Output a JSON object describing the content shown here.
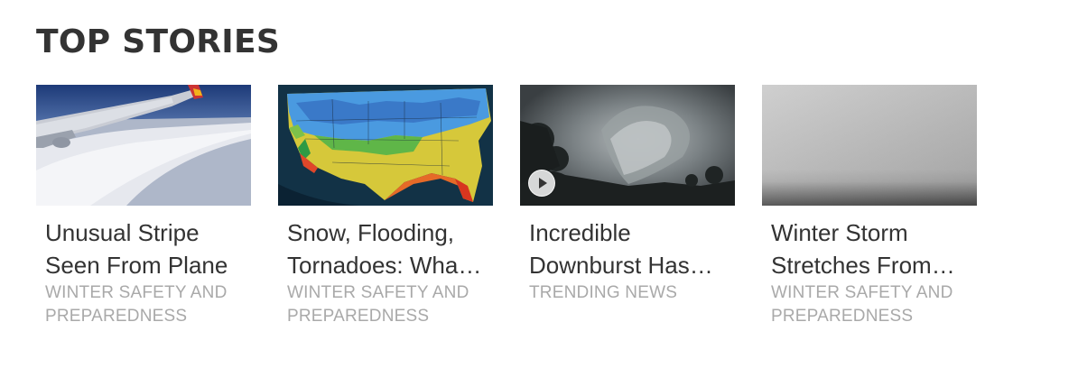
{
  "section": {
    "title": "TOP STORIES"
  },
  "cards": [
    {
      "title": "Unusual Stripe Seen From Plane",
      "category": "WINTER SAFETY AND PREPAREDNESS",
      "image": "airplane-wing-over-clouds",
      "has_video": false
    },
    {
      "title": "Snow, Flooding, Tornadoes: What to Expect",
      "category": "WINTER SAFETY AND PREPAREDNESS",
      "image": "us-weather-map",
      "has_video": false
    },
    {
      "title": "Incredible Downburst Has Everyone Talking",
      "category": "TRENDING NEWS",
      "image": "storm-cloud",
      "has_video": true
    },
    {
      "title": "Winter Storm Stretches From Coast to Coast",
      "category": "WINTER SAFETY AND PREPAREDNESS",
      "image": "gray-fog",
      "has_video": false
    }
  ]
}
